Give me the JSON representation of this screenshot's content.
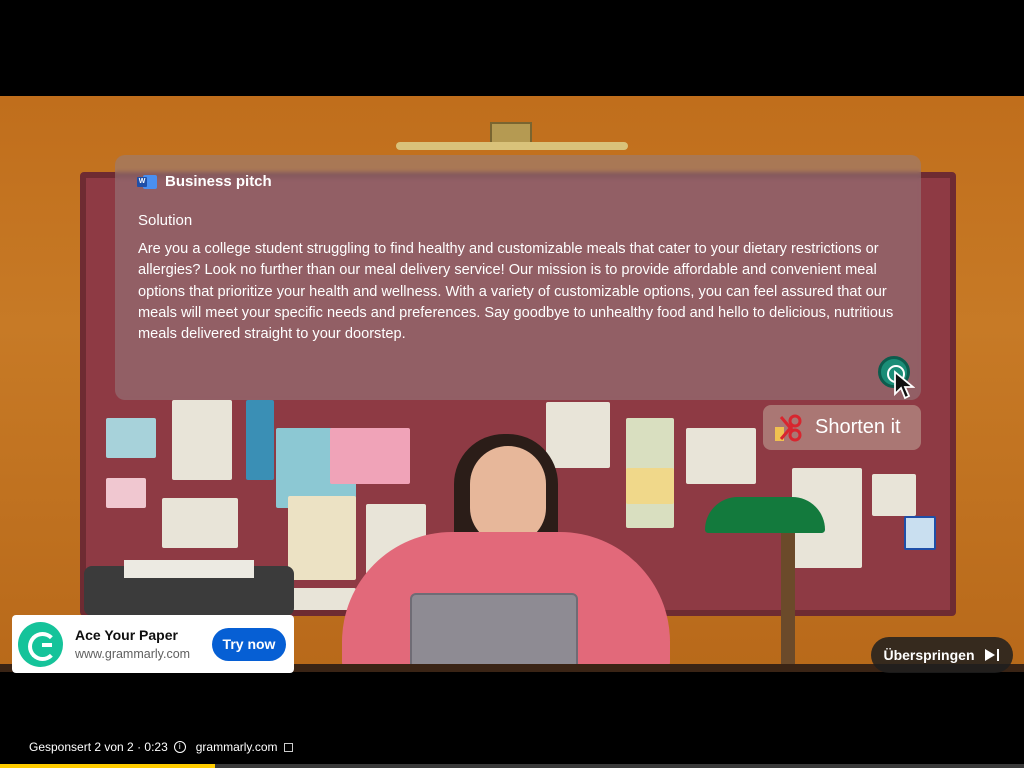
{
  "document": {
    "title": "Business pitch",
    "section": "Solution",
    "body": "Are you a college student struggling to find healthy and customizable meals that cater to your dietary restrictions or allergies? Look no further than our meal delivery service! Our mission is to provide affordable and convenient meal options that prioritize your health and wellness. With a variety of customizable options, you can feel assured that our meals will meet your specific needs and preferences. Say goodbye to unhealthy food and hello to delicious, nutritious meals delivered straight to your doorstep."
  },
  "suggestion": {
    "label": "Shorten it"
  },
  "ad": {
    "title": "Ace Your Paper",
    "url": "www.grammarly.com",
    "cta": "Try now"
  },
  "skip": {
    "label": "Überspringen"
  },
  "status": {
    "sponsored": "Gesponsert 2 von 2 · 0:23",
    "domain": "grammarly.com"
  },
  "progress": {
    "fraction": 0.21,
    "color": "#ffcc00"
  },
  "colors": {
    "accent": "#065fd4",
    "grammarly": "#15c39a"
  }
}
